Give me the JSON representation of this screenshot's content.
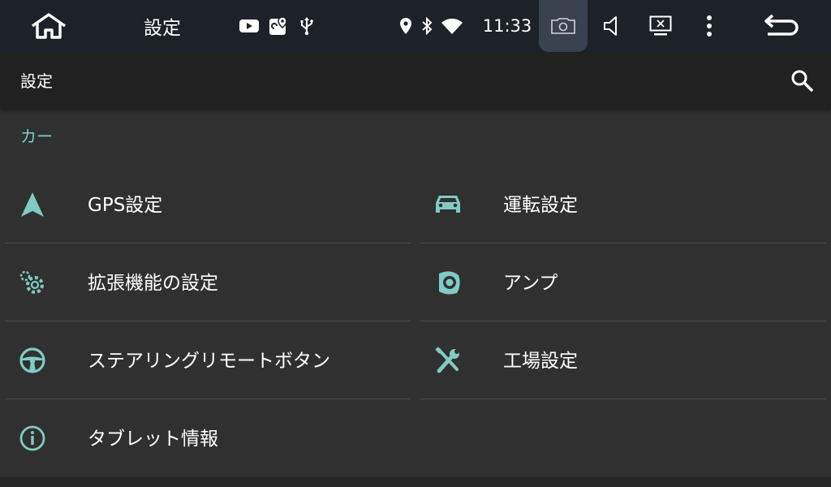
{
  "status_bar": {
    "title": "設定",
    "time": "11:33",
    "icons": [
      "home-icon",
      "youtube-icon",
      "maps-icon",
      "usb-icon",
      "location-icon",
      "bluetooth-icon",
      "wifi-icon",
      "screenshot-icon",
      "volume-icon",
      "close-window-icon",
      "more-vert-icon",
      "back-icon"
    ]
  },
  "toolbar": {
    "title": "設定",
    "search_icon": "search-icon"
  },
  "category": {
    "label": "カー"
  },
  "tiles": [
    {
      "label": "GPS設定",
      "icon": "navigation-arrow-icon"
    },
    {
      "label": "運転設定",
      "icon": "car-icon"
    },
    {
      "label": "拡張機能の設定",
      "icon": "extended-settings-gears-icon"
    },
    {
      "label": "アンプ",
      "icon": "speaker-icon"
    },
    {
      "label": "ステアリングリモートボタン",
      "icon": "steering-wheel-icon"
    },
    {
      "label": "工場設定",
      "icon": "tools-icon"
    },
    {
      "label": "タブレット情報",
      "icon": "info-icon"
    }
  ],
  "colors": {
    "accent": "#80cbc4",
    "status_bar_bg": "#1d2128",
    "toolbar_bg": "#212121",
    "page_bg": "#303030",
    "divider": "#4a4a4a"
  }
}
